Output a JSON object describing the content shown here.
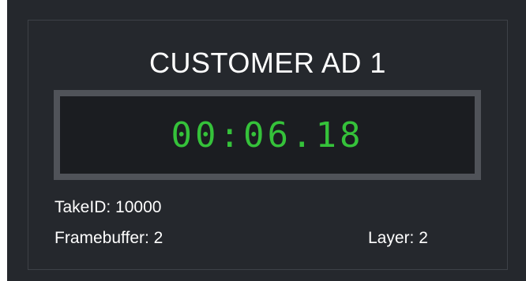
{
  "panel": {
    "title": "CUSTOMER AD 1",
    "timer": "00:06.18",
    "take_id": "TakeID: 10000",
    "framebuffer": "Framebuffer: 2",
    "layer": "Layer: 2"
  },
  "colors": {
    "background": "#25282d",
    "timer_green": "#35c23a",
    "text": "#ffffff"
  }
}
